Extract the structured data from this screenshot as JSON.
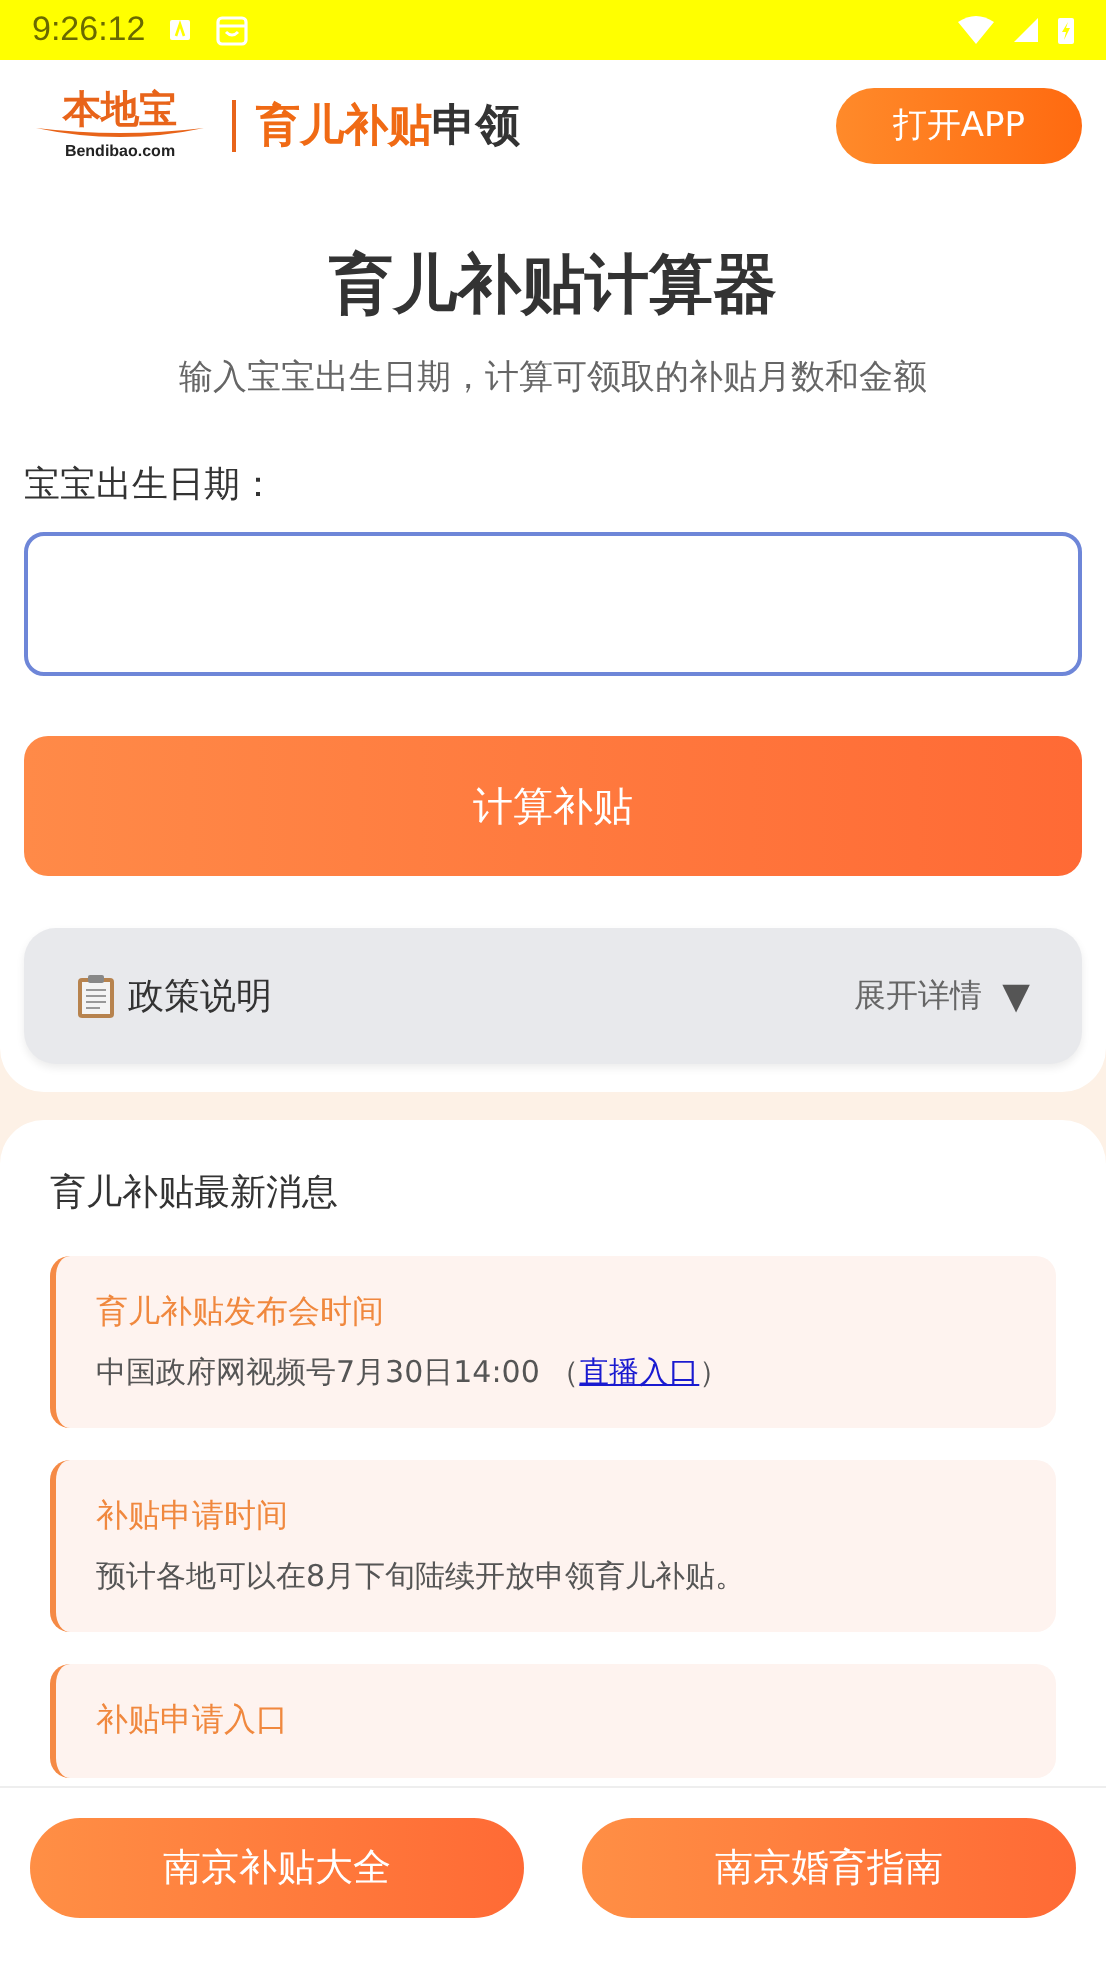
{
  "status_bar": {
    "time": "9:26:12"
  },
  "header": {
    "logo_text": "本地宝",
    "logo_domain": "Bendibao.com",
    "title_highlight": "育儿补贴",
    "title_rest": "申领",
    "open_app_button": "打开APP"
  },
  "calculator": {
    "title": "育儿补贴计算器",
    "subtitle": "输入宝宝出生日期，计算可领取的补贴月数和金额",
    "field_label": "宝宝出生日期：",
    "calculate_button": "计算补贴"
  },
  "policy": {
    "title": "政策说明",
    "toggle": "展开详情",
    "toggle_icon": "▼",
    "expanded": false
  },
  "news": {
    "title": "育儿补贴最新消息",
    "items": [
      {
        "title": "育儿补贴发布会时间",
        "body": "中国政府网视频号7月30日14:00 （",
        "link": "直播入口",
        "body_end": "）"
      },
      {
        "title": "补贴申请时间",
        "body": "预计各地可以在8月下旬陆续开放申领育儿补贴。"
      },
      {
        "title": "补贴申请入口"
      }
    ]
  },
  "footer": {
    "buttons": [
      "南京补贴大全",
      "南京婚育指南"
    ]
  }
}
